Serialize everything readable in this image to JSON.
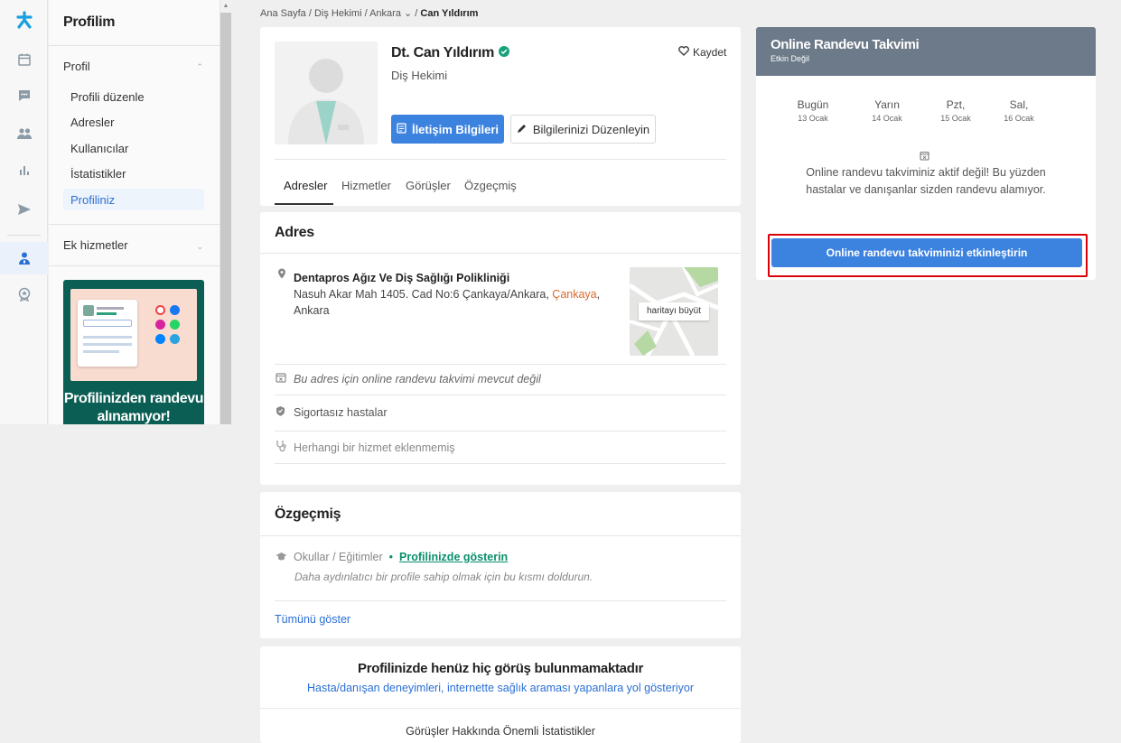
{
  "rail": {
    "icons": [
      "logo-icon",
      "calendar-icon",
      "chat-icon",
      "users-icon",
      "stats-icon",
      "send-icon",
      "doctor-icon",
      "badge-icon"
    ]
  },
  "sidebar": {
    "title": "Profilim",
    "profile_section": "Profil",
    "items": [
      {
        "label": "Profili düzenle"
      },
      {
        "label": "Adresler"
      },
      {
        "label": "Kullanıcılar"
      },
      {
        "label": "İstatistikler"
      },
      {
        "label": "Profiliniz"
      }
    ],
    "extra_section": "Ek hizmetler",
    "promo_text": "Profilinizden randevu alınamıyor!"
  },
  "breadcrumb": {
    "home": "Ana Sayfa",
    "sep": "/",
    "category": "Diş Hekimi",
    "city": "Ankara",
    "current": "Can Yıldırım"
  },
  "profile": {
    "name": "Dt. Can Yıldırım",
    "specialty": "Diş Hekimi",
    "save_label": "Kaydet",
    "contact_button": "İletişim Bilgileri",
    "edit_button": "Bilgilerinizi Düzenleyin",
    "tabs": [
      "Adresler",
      "Hizmetler",
      "Görüşler",
      "Özgeçmiş"
    ],
    "active_tab": "Adresler"
  },
  "address": {
    "heading": "Adres",
    "clinic": "Dentapros Ağız Ve Diş Sağlığı Polikliniği",
    "street": "Nasuh Akar Mah 1405. Cad No:6 Çankaya/Ankara,",
    "district": "Çankaya",
    "city": "Ankara",
    "map_button": "haritayı büyüt",
    "no_calendar": "Bu adres için online randevu takvimi mevcut değil",
    "insurance": "Sigortasız hastalar",
    "no_service": "Herhangi bir hizmet eklenmemiş"
  },
  "resume": {
    "heading": "Özgeçmiş",
    "schools_label": "Okullar / Eğitimler",
    "bullet": "•",
    "show_link": "Profilinizde gösterin",
    "hint": "Daha aydınlatıcı bir profile sahip olmak için bu kısmı doldurun.",
    "show_all": "Tümünü göster"
  },
  "reviews": {
    "heading": "Profilinizde henüz hiç görüş bulunmamaktadır",
    "subtext": "Hasta/danışan deneyimleri, internette sağlık araması yapanlara yol gösteriyor",
    "stats_title": "Görüşler Hakkında Önemli İstatistikler"
  },
  "calendar": {
    "title": "Online Randevu Takvimi",
    "status": "Etkin Değil",
    "days": [
      {
        "name": "Bugün",
        "date": "13 Ocak"
      },
      {
        "name": "Yarın",
        "date": "14 Ocak"
      },
      {
        "name": "Pzt,",
        "date": "15 Ocak"
      },
      {
        "name": "Sal,",
        "date": "16 Ocak"
      }
    ],
    "message": "Online randevu takviminiz aktif değil! Bu yüzden hastalar ve danışanlar sizden randevu alamıyor.",
    "activate_button": "Online randevu takviminizi etkinleştirin",
    "highlight_color": "#d9000a"
  },
  "colors": {
    "primary": "#3c82df",
    "verified": "#16a37a",
    "link_green": "#0a8f6c",
    "header_gray": "#6c7a89"
  }
}
